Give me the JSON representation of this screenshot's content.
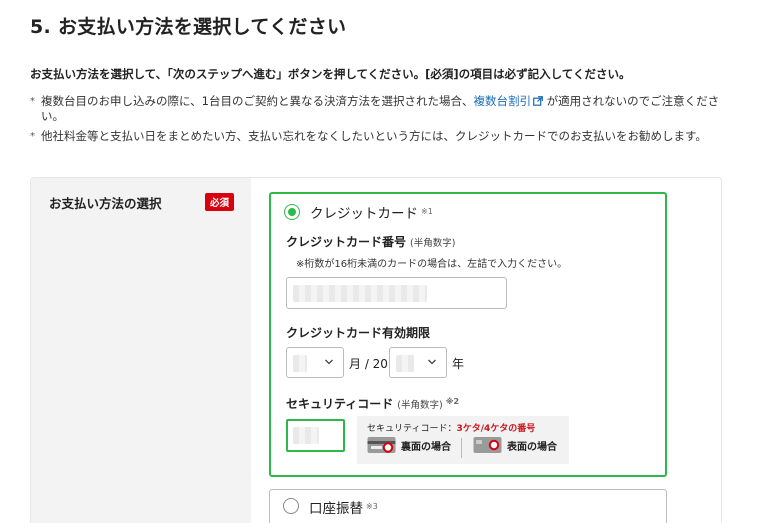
{
  "page": {
    "title": "5. お支払い方法を選択してください",
    "intro": "お支払い方法を選択して、「次のステップへ進む」ボタンを押してください。[必須]の項目は必ず記入してください。",
    "notes": [
      {
        "bullet": "*",
        "before": "複数台目のお申し込みの際に、1台目のご契約と異なる決済方法を選択された場合、",
        "link": "複数台割引",
        "after": " が適用されないのでご注意ください。"
      },
      {
        "bullet": "*",
        "text": "他社料金等と支払い日をまとめたい方、支払い忘れをなくしたいという方には、クレジットカードでのお支払いをお勧めします。"
      }
    ]
  },
  "payment": {
    "label": "お支払い方法の選択",
    "required_badge": "必須",
    "credit": {
      "title": "クレジットカード",
      "sup": "※1",
      "selected": true,
      "card_number": {
        "label": "クレジットカード番号",
        "note": "(半角数字)",
        "hint": "※桁数が16桁未満のカードの場合は、左詰で入力ください。"
      },
      "expiry": {
        "label": "クレジットカード有効期限",
        "month_suffix": "月 / 20",
        "year_suffix": "年"
      },
      "security": {
        "label": "セキュリティコード",
        "note": "(半角数字)",
        "sup": "※2",
        "caption_prefix": "セキュリティコード：",
        "caption_emph": "3ケタ/4ケタの番号",
        "back_label": "裏面の場合",
        "front_label": "表面の場合"
      }
    },
    "bank": {
      "title": "口座振替",
      "sup": "※3",
      "selected": false
    }
  },
  "colors": {
    "accent_green": "#2eb84a",
    "required_red": "#d7000f",
    "link_blue": "#1a6bb5",
    "emphasis_red": "#c8141e"
  },
  "icons": [
    "external-link-icon",
    "chevron-down-icon",
    "card-back-icon",
    "card-front-icon"
  ]
}
